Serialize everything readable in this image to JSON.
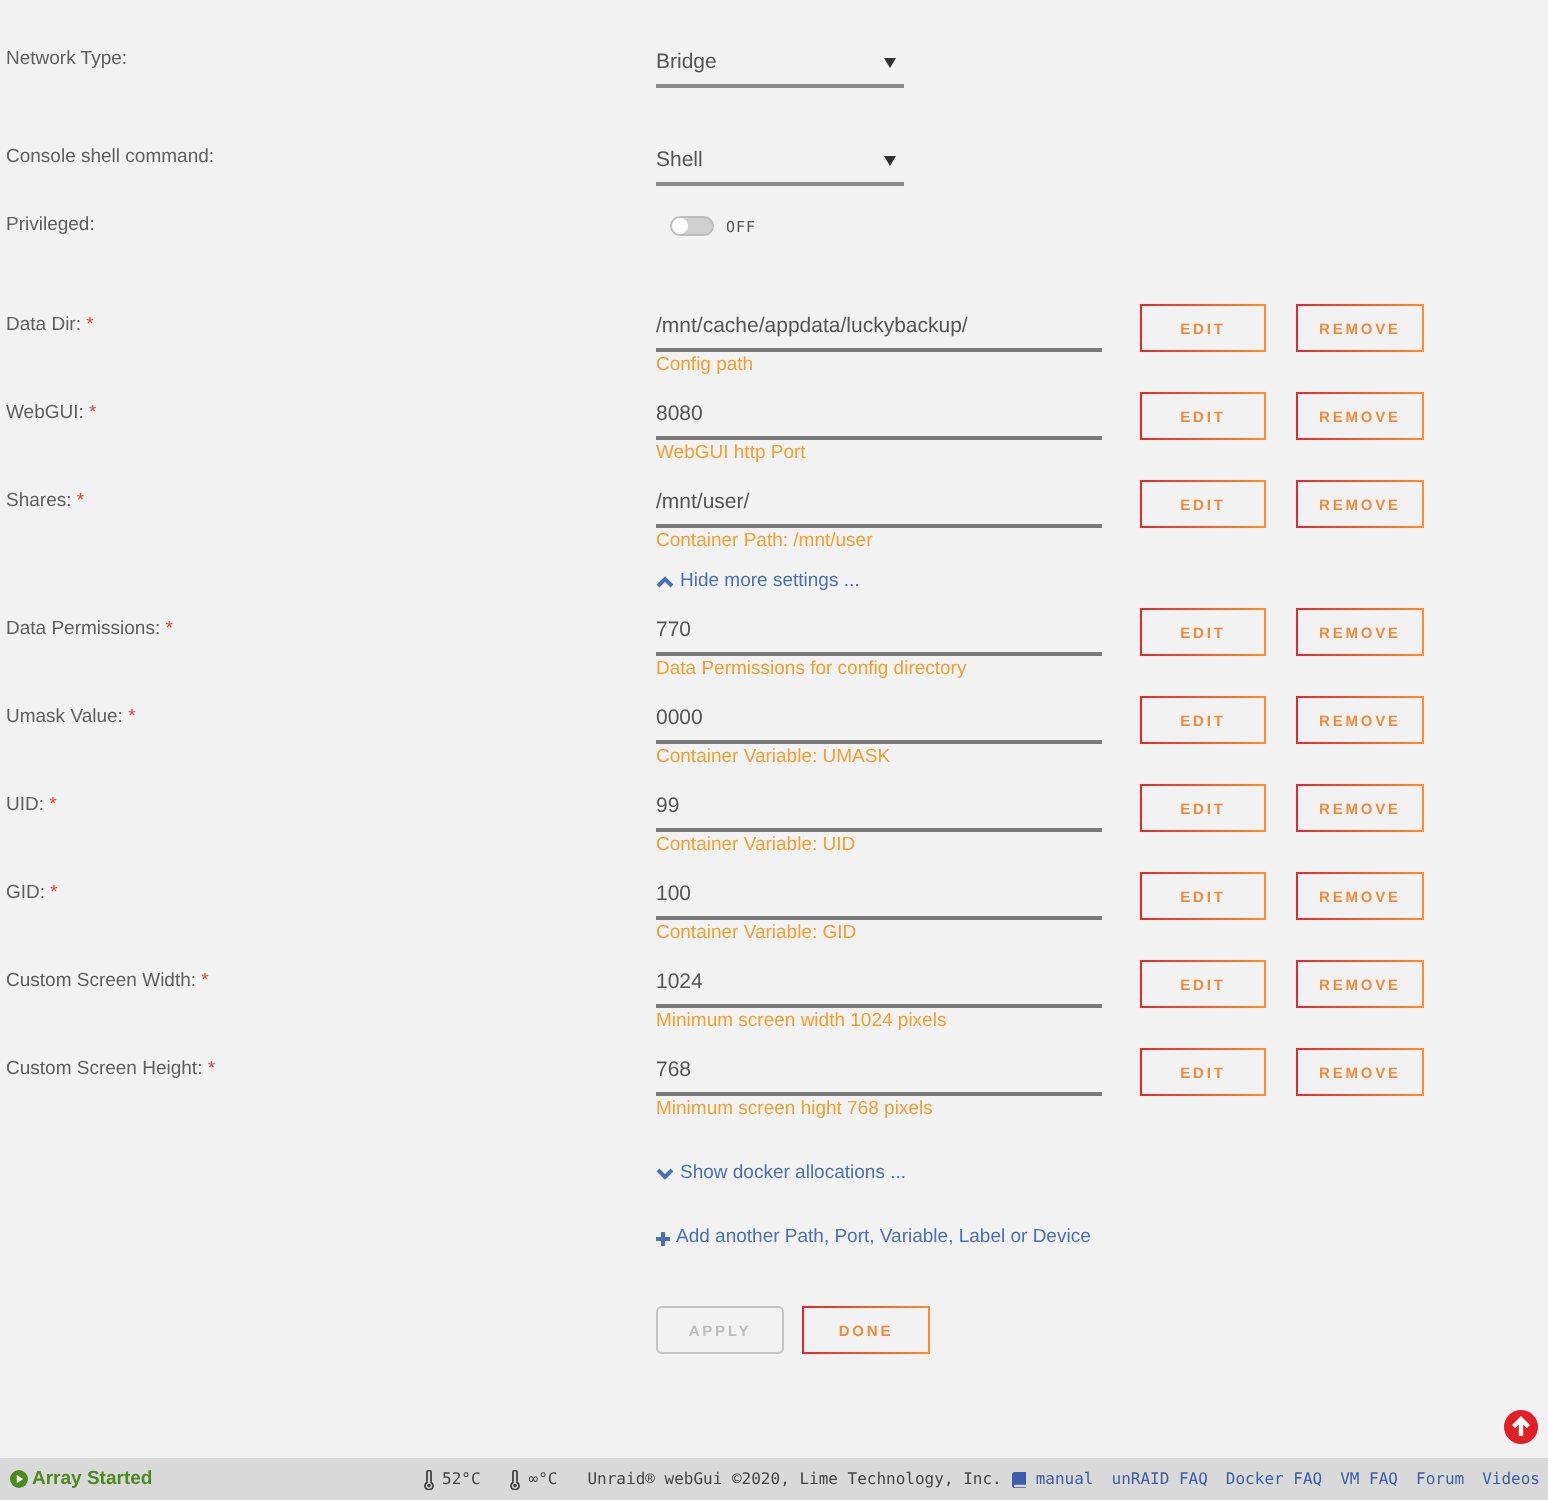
{
  "form": {
    "settings": [
      {
        "kind": "select",
        "label": "Network Type:",
        "value": "Bridge"
      },
      {
        "kind": "select",
        "label": "Console shell command:",
        "value": "Shell"
      },
      {
        "kind": "toggle",
        "label": "Privileged:",
        "on": false,
        "state_text": "OFF"
      }
    ],
    "params": [
      {
        "label": "Data Dir:",
        "mark": "*",
        "value": "/mnt/cache/appdata/luckybackup/",
        "description": "Config path",
        "buttons": [
          "EDIT",
          "REMOVE"
        ]
      },
      {
        "label": "WebGUI:",
        "mark": "*",
        "value": "8080",
        "description": "WebGUI http Port",
        "buttons": [
          "EDIT",
          "REMOVE"
        ]
      },
      {
        "label": "Shares:",
        "mark": "*",
        "value": "/mnt/user/",
        "description": "Container Path: /mnt/user",
        "buttons": [
          "EDIT",
          "REMOVE"
        ]
      }
    ],
    "more_settings": {
      "text": "Hide more settings ...",
      "expanded": true
    },
    "advanced_params": [
      {
        "label": "Data Permissions:",
        "mark": "*",
        "value": "770",
        "description": "Data Permissions for config directory",
        "buttons": [
          "EDIT",
          "REMOVE"
        ]
      },
      {
        "label": "Umask Value:",
        "mark": "*",
        "value": "0000",
        "description": "Container Variable: UMASK",
        "buttons": [
          "EDIT",
          "REMOVE"
        ]
      },
      {
        "label": "UID:",
        "mark": "*",
        "value": "99",
        "description": "Container Variable: UID",
        "buttons": [
          "EDIT",
          "REMOVE"
        ]
      },
      {
        "label": "GID:",
        "mark": "*",
        "value": "100",
        "description": "Container Variable: GID",
        "buttons": [
          "EDIT",
          "REMOVE"
        ]
      },
      {
        "label": "Custom Screen Width:",
        "mark": "*",
        "value": "1024",
        "description": "Minimum screen width 1024 pixels",
        "buttons": [
          "EDIT",
          "REMOVE"
        ]
      },
      {
        "label": "Custom Screen Height:",
        "mark": "*",
        "value": "768",
        "description": "Minimum screen hight 768 pixels",
        "buttons": [
          "EDIT",
          "REMOVE"
        ]
      }
    ],
    "docker_allocations": {
      "text": "Show docker allocations ...",
      "expanded": false
    },
    "add_link": {
      "text": "Add another Path, Port, Variable, Label or Device"
    },
    "actions": [
      {
        "label": "APPLY",
        "disabled": true
      },
      {
        "label": "DONE",
        "disabled": false
      }
    ]
  },
  "status_bar": {
    "array_status": "Array Started",
    "temperatures": [
      "52°C",
      "∞°C"
    ],
    "copyright": "Unraid® webGui ©2020, Lime Technology, Inc.",
    "links": [
      {
        "kind": "book",
        "text": "manual"
      },
      {
        "kind": "plain",
        "text": "unRAID FAQ"
      },
      {
        "kind": "plain",
        "text": "Docker FAQ"
      },
      {
        "kind": "plain",
        "text": "VM FAQ"
      },
      {
        "kind": "plain",
        "text": "Forum"
      },
      {
        "kind": "plain",
        "text": "Videos"
      }
    ]
  }
}
